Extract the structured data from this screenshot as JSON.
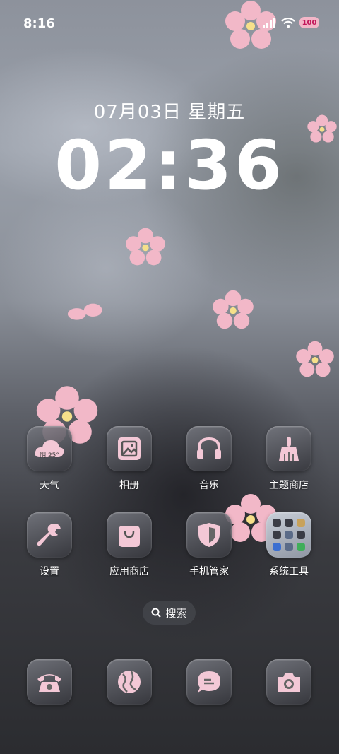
{
  "status_bar": {
    "time": "8:16",
    "battery": "100"
  },
  "lockclock": {
    "date": "07月03日  星期五",
    "time": "02:36"
  },
  "weather_icon_text": "阴 25°",
  "apps": [
    {
      "id": "weather",
      "label": "天气"
    },
    {
      "id": "gallery",
      "label": "相册"
    },
    {
      "id": "music",
      "label": "音乐"
    },
    {
      "id": "themes",
      "label": "主题商店"
    },
    {
      "id": "settings",
      "label": "设置"
    },
    {
      "id": "appstore",
      "label": "应用商店"
    },
    {
      "id": "phone-manager",
      "label": "手机管家"
    },
    {
      "id": "system-tools",
      "label": "系统工具"
    }
  ],
  "search": {
    "label": "搜索"
  },
  "dock": [
    "phone",
    "browser",
    "messages",
    "camera"
  ],
  "colors": {
    "icon_pink": "#f3c8d6",
    "petal": "#f2b8c8"
  }
}
